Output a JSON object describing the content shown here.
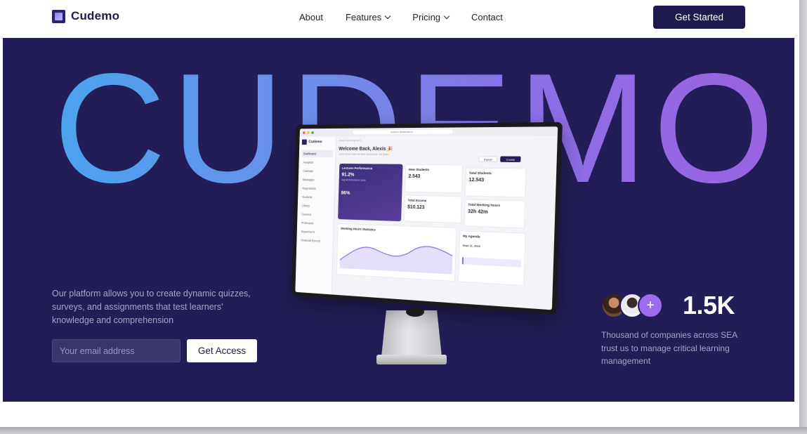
{
  "nav": {
    "brand": "Cudemo",
    "items": [
      {
        "label": "About",
        "dropdown": false
      },
      {
        "label": "Features",
        "dropdown": true
      },
      {
        "label": "Pricing",
        "dropdown": true
      },
      {
        "label": "Contact",
        "dropdown": false
      }
    ],
    "cta_label": "Get Started"
  },
  "hero": {
    "headline": "CUDEMO",
    "description": "Our platform allows you to create dynamic quizzes, surveys, and assignments that test learners' knowledge and comprehension",
    "email_placeholder": "Your email address",
    "submit_label": "Get Access",
    "stat_value": "1.5K",
    "stat_plus": "+",
    "stat_description": "Thousand of companies across SEA trust us to manage critical learning management"
  },
  "dashboard": {
    "brand": "Cudemo",
    "url": "cudemo.dashboard.io",
    "search_placeholder": "Search anything here...",
    "sidebar_items": [
      "Dashboard",
      "Analytics",
      "Calendar",
      "Messages",
      "Registration",
      "Students",
      "Library",
      "Courses",
      "Professors",
      "Department",
      "Financial Record"
    ],
    "welcome": "Welcome Back, Alexis 🎉",
    "welcome_sub": "Lorem ipsum dolor sit amet consectetur. Dui quam.",
    "export_label": "Export",
    "create_label": "Create",
    "lecturer_title": "Lecturer Performance",
    "lecturer_value": "91.2%",
    "lecturer_sub": "Avg All Performance Score",
    "lecturer_bottom": "86%",
    "new_students_title": "New Students",
    "new_students_value": "2.543",
    "total_students_title": "Total Students",
    "total_students_value": "12.543",
    "total_income_title": "Total Income",
    "total_income_value": "$10.123",
    "working_hours_title": "Total Working Hours",
    "working_hours_value": "32h 42m",
    "stats_title": "Working Hours Statistics",
    "agenda_title": "My Agenda",
    "agenda_date": "Sept 11, 2023"
  },
  "colors": {
    "hero_bg": "#221d56",
    "brand_dark": "#1e1a4e",
    "gradient_start": "#4aa3ef",
    "gradient_end": "#9b62e0"
  }
}
